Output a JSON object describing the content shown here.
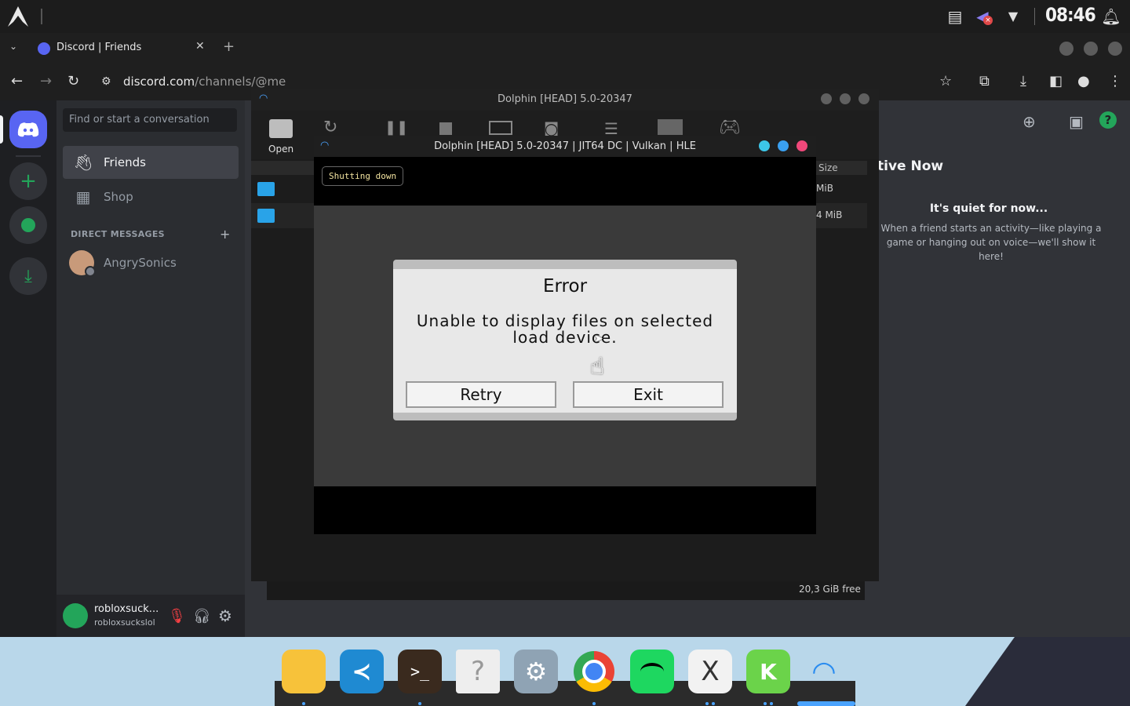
{
  "system": {
    "clock": "08:46"
  },
  "browser": {
    "tab_title": "Discord | Friends",
    "url_domain": "discord.com",
    "url_path": "/channels/@me"
  },
  "discord": {
    "search_placeholder": "Find or start a conversation",
    "nav": [
      {
        "label": "Friends"
      },
      {
        "label": "Shop"
      }
    ],
    "dm_header": "DIRECT MESSAGES",
    "dms": [
      {
        "name": "AngrySonics"
      }
    ],
    "user": {
      "display_name": "robloxsuck...",
      "username": "robloxsuckslol"
    },
    "active_now_title": "tive Now",
    "quiet_title": "It's quiet for now...",
    "quiet_text": "When a friend starts an activity—like playing a game or hanging out on voice—we'll show it here!"
  },
  "dolphin": {
    "title": "Dolphin [HEAD] 5.0-20347",
    "open_label": "Open",
    "size_header": "Size",
    "rows": [
      {
        "size": "MiB"
      },
      {
        "size": "4 MiB"
      }
    ],
    "free_space": "20,3 GiB free",
    "render_title": "Dolphin [HEAD] 5.0-20347 | JIT64 DC | Vulkan | HLE",
    "toast": "Shutting down",
    "error": {
      "title": "Error",
      "message": "Unable to display files on selected load device.",
      "retry": "Retry",
      "exit": "Exit"
    }
  },
  "dock": {
    "apps": [
      "files-icon",
      "vscode-icon",
      "terminal-icon",
      "unknown-app-icon",
      "settings-icon",
      "chrome-icon",
      "spotify-icon",
      "xorg-icon",
      "kdeconnect-icon",
      "dolphin-emulator-icon"
    ]
  },
  "colors": {
    "discord_blurple": "#5865f2",
    "discord_green": "#23a55a",
    "accent_blue": "#4aa3ff"
  }
}
